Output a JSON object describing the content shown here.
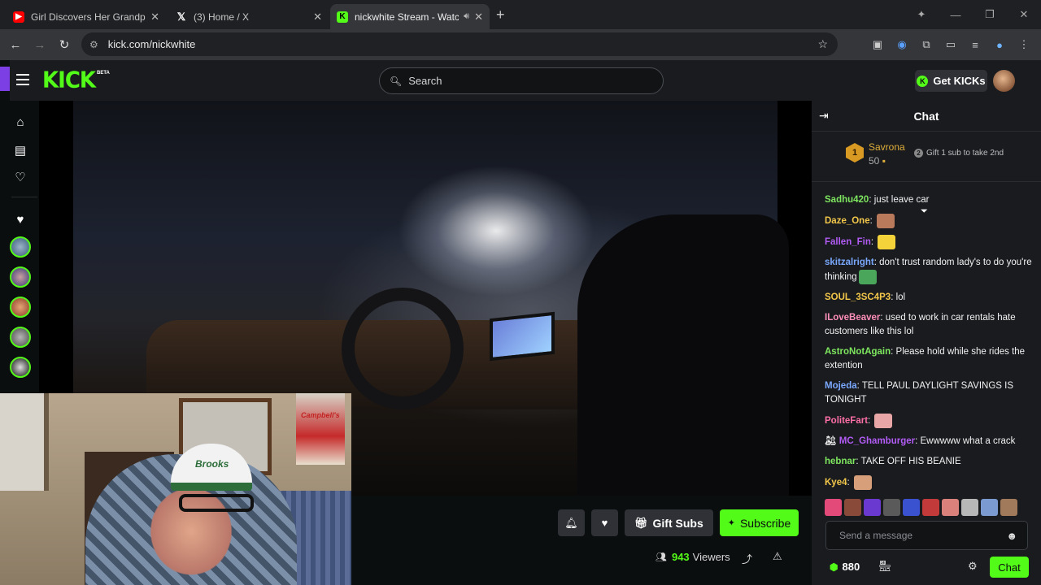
{
  "browser": {
    "tabs": [
      {
        "title": "Girl Discovers Her Grandpa Is A",
        "icon": "youtube-icon"
      },
      {
        "title": "(3) Home / X",
        "icon": "x-icon"
      },
      {
        "title": "nickwhite Stream - Watch Li",
        "icon": "kick-icon"
      }
    ],
    "url": "kick.com/nickwhite"
  },
  "header": {
    "logo": "KICK",
    "beta": "BETA",
    "search_placeholder": "Search",
    "get_kicks": "Get KICKs"
  },
  "webcam": {
    "hat_text": "Brooks",
    "poster_text": "Campbell's"
  },
  "actions": {
    "gift_subs": "Gift Subs",
    "subscribe": "Subscribe",
    "viewers_count": "943",
    "viewers_label": "Viewers"
  },
  "chat": {
    "title": "Chat",
    "top_gifter": {
      "rank": "1",
      "name": "Savrona",
      "count": "50"
    },
    "gift_prompt": "Gift 1 sub to take 2nd",
    "messages": [
      {
        "user": "Sadhu420",
        "color": "#7ee65f",
        "text": "just leave car"
      },
      {
        "user": "Daze_One",
        "color": "#f3c74a",
        "text": ""
      },
      {
        "user": "Fallen_Fin",
        "color": "#b25cf5",
        "text": ""
      },
      {
        "user": "skitzalright",
        "color": "#7aa9ff",
        "text": "don't trust random lady's to do you're thinking"
      },
      {
        "user": "SOUL_3SC4P3",
        "color": "#f3c74a",
        "text": "lol"
      },
      {
        "user": "ILoveBeaver",
        "color": "#ff8fb8",
        "text": "used to work in car rentals hate customers like this lol"
      },
      {
        "user": "AstroNotAgain",
        "color": "#7ee65f",
        "text": "Please hold while she rides the extention"
      },
      {
        "user": "Mojeda",
        "color": "#7aa9ff",
        "text": "TELL PAUL DAYLIGHT SAVINGS IS TONIGHT"
      },
      {
        "user": "PoliteFart",
        "color": "#ff6fa8",
        "text": ""
      },
      {
        "user": "MC_Ghamburger",
        "color": "#b25cf5",
        "text": "Ewwwww what a crack"
      },
      {
        "user": "hebnar",
        "color": "#7ee65f",
        "text": "TAKE OFF HIS BEANIE"
      },
      {
        "user": "Kye4",
        "color": "#f3c74a",
        "text": ""
      }
    ],
    "input_placeholder": "Send a message",
    "kicks_count": "880",
    "chat_button": "Chat"
  },
  "colors": {
    "accent": "#53fc18",
    "brand_purple": "#7b3fe4"
  }
}
